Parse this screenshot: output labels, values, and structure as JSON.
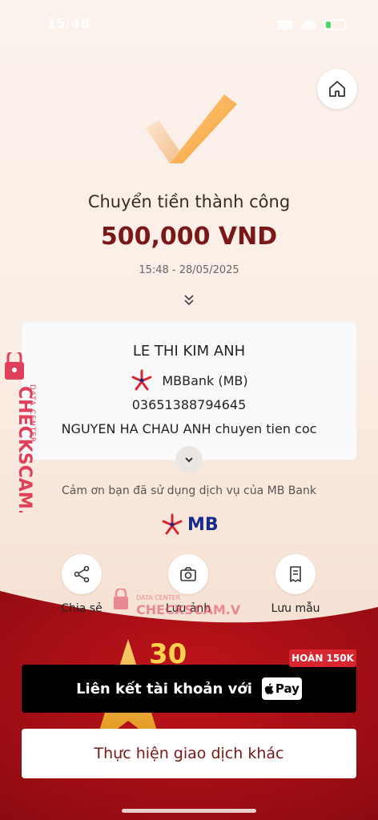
{
  "status": {
    "time": "15:48"
  },
  "header": {
    "home_icon": "home-icon"
  },
  "result": {
    "title": "Chuyển tiền thành công",
    "amount": "500,000 VND",
    "datetime": "15:48 - 28/05/2025"
  },
  "recipient": {
    "name": "LE THI KIM ANH",
    "bank": "MBBank (MB)",
    "account": "03651388794645",
    "note": "NGUYEN HA CHAU ANH chuyen tien coc"
  },
  "thanks": "Cảm ơn bạn đã sử dụng dịch vụ của MB Bank",
  "brand": {
    "logo_text": "MB",
    "primary": "#1a2a8a",
    "accent": "#d9262e"
  },
  "actions": [
    {
      "label": "Chia sẻ",
      "icon": "share-icon"
    },
    {
      "label": "Lưu ảnh",
      "icon": "camera-icon"
    },
    {
      "label": "Lưu mẫu",
      "icon": "receipt-icon"
    }
  ],
  "promo": {
    "badge": "HOÀN 150K",
    "button_label": "Liên kết tài khoản với",
    "pay_label": "Pay",
    "banner_number": "30"
  },
  "other_button": "Thực hiện giao dịch khác",
  "watermark": {
    "site": "CHECKSCAM.VN",
    "sub": "DATA CENTER",
    "center_sub": "DATA CENTER",
    "center_main": "CHECKSCAM.VN"
  }
}
